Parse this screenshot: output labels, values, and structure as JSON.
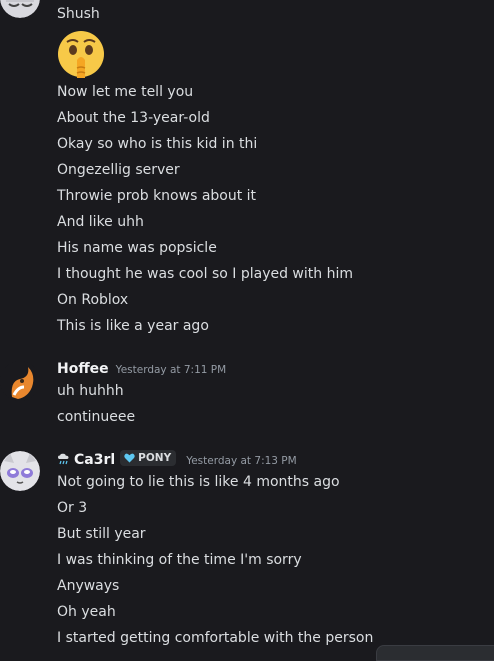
{
  "messages": {
    "first_group_top_line": "Shush",
    "emoji": "shushing-face-emoji",
    "first_group": [
      "Now let me tell you",
      "About the 13-year-old",
      "Okay so who is this kid in thi",
      "Ongezellig server",
      "Throwie prob knows about it",
      "And like uhh",
      "His name was popsicle",
      "I thought he was cool so I played with him",
      "On Roblox",
      "This is like a year ago"
    ],
    "hoffee": {
      "username": "Hoffee",
      "timestamp": "Yesterday at 7:11 PM",
      "lines": [
        "uh huhhh",
        "continueee"
      ]
    },
    "ca3rl": {
      "icon": "cloud-rain-icon",
      "username": "Ca3rl",
      "badge": "PONY",
      "badge_icon": "heart-icon",
      "timestamp": "Yesterday at 7:13 PM",
      "lines": [
        "Not going to lie this is like 4 months ago",
        "Or 3",
        "But still year",
        "I was thinking of the time I'm sorry",
        "Anyways",
        "Oh yeah",
        "I started getting comfortable with the person"
      ]
    }
  },
  "colors": {
    "background": "#1a1a1e",
    "text": "#dbdee1",
    "username": "#f2f3f5",
    "timestamp": "#949ba4",
    "badge_heart": "#5ec8f2"
  }
}
